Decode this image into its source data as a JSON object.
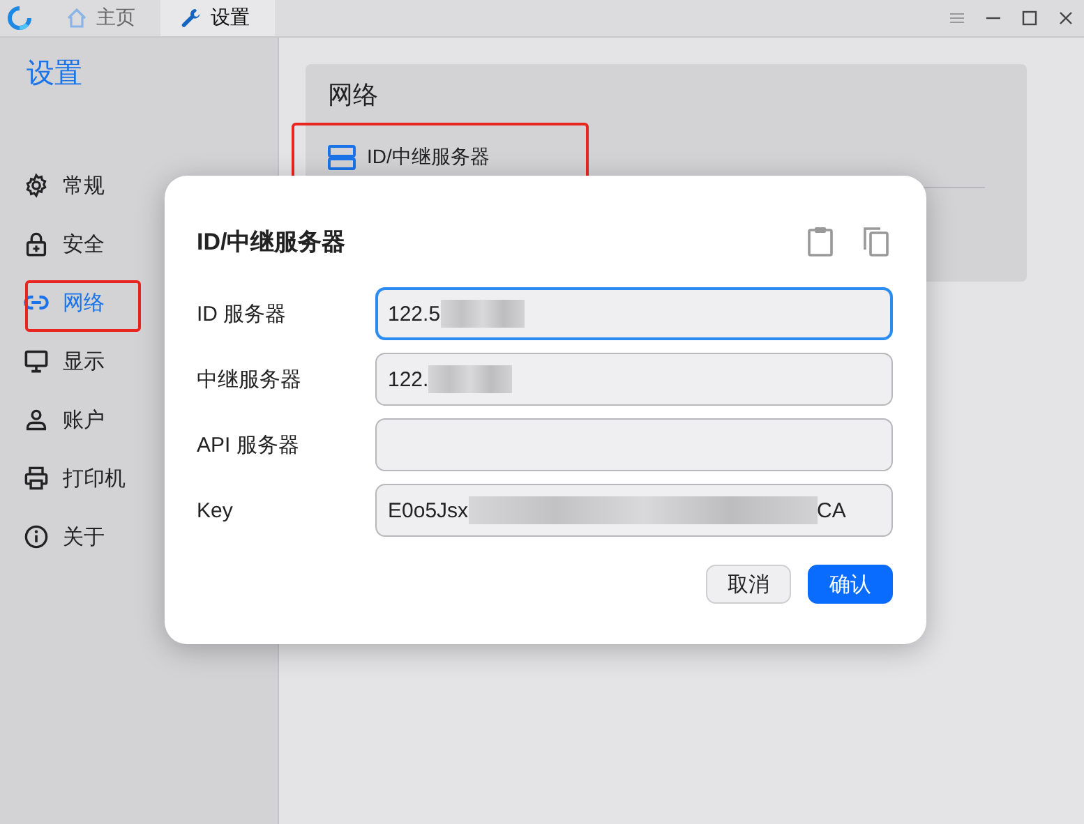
{
  "tabs": [
    {
      "label": "主页",
      "selected": false
    },
    {
      "label": "设置",
      "selected": true
    }
  ],
  "sidebar": {
    "title": "设置",
    "items": [
      {
        "label": "常规",
        "selected": false,
        "highlighted": false
      },
      {
        "label": "安全",
        "selected": false,
        "highlighted": false
      },
      {
        "label": "网络",
        "selected": true,
        "highlighted": true
      },
      {
        "label": "显示",
        "selected": false,
        "highlighted": false
      },
      {
        "label": "账户",
        "selected": false,
        "highlighted": false
      },
      {
        "label": "打印机",
        "selected": false,
        "highlighted": false
      },
      {
        "label": "关于",
        "selected": false,
        "highlighted": false
      }
    ]
  },
  "section": {
    "title": "网络",
    "items": [
      {
        "label": "ID/中继服务器",
        "highlighted": true
      }
    ]
  },
  "dialog": {
    "title": "ID/中继服务器",
    "fields": [
      {
        "label": "ID 服务器",
        "value": "122.5",
        "redacted": true,
        "focused": true
      },
      {
        "label": "中继服务器",
        "value": "122.",
        "redacted": true,
        "focused": false
      },
      {
        "label": "API 服务器",
        "focused": false
      },
      {
        "label": "Key",
        "value": "E0o5Jsx",
        "redacted": true,
        "value_end": "CA",
        "focused": false
      }
    ],
    "buttons": [
      {
        "label": "取消",
        "kind": "secondary"
      },
      {
        "label": "确认",
        "kind": "primary"
      }
    ]
  }
}
